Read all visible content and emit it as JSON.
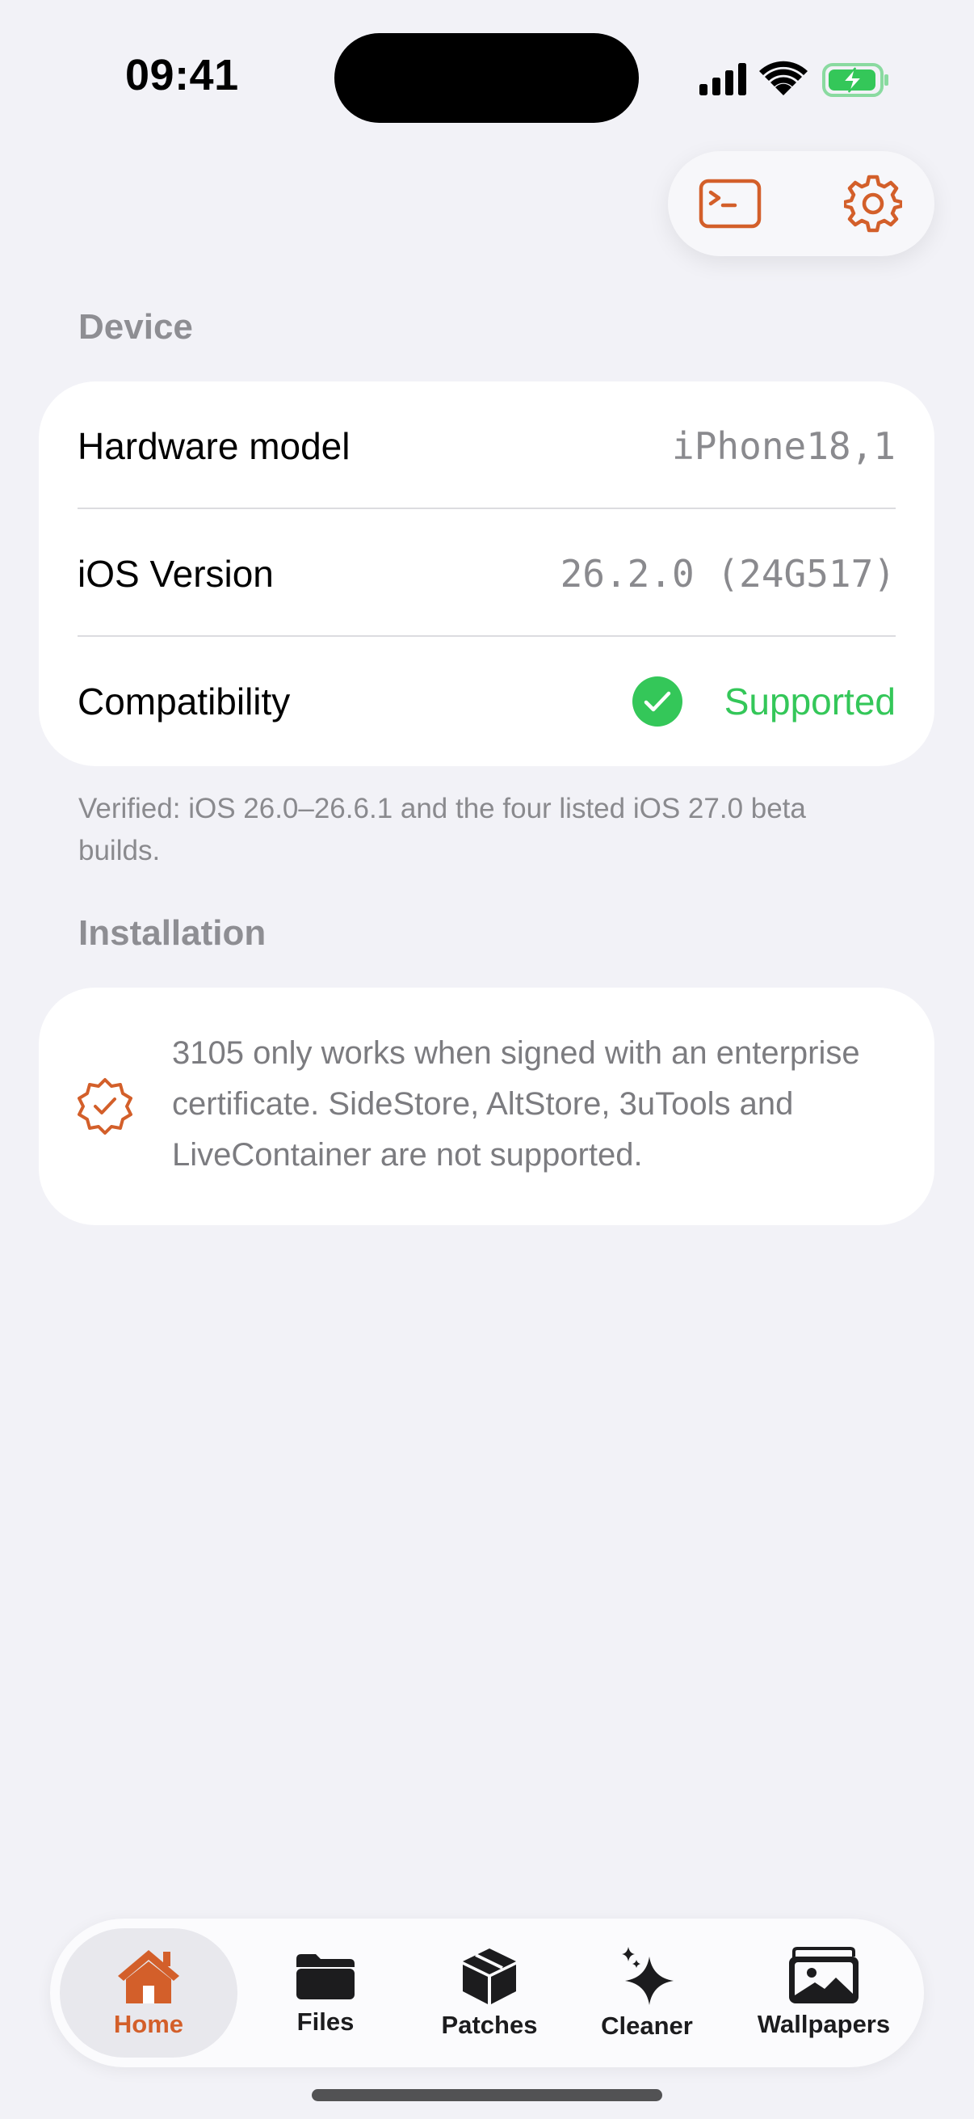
{
  "status_bar": {
    "time": "09:41"
  },
  "colors": {
    "accent": "#d35f2a",
    "success": "#34c759",
    "background": "#f2f2f7"
  },
  "toolbar": {
    "terminal_icon": "terminal-icon",
    "settings_icon": "gear-icon"
  },
  "device": {
    "header": "Device",
    "rows": [
      {
        "label": "Hardware model",
        "value": "iPhone18,1"
      },
      {
        "label": "iOS Version",
        "value": "26.2.0 (24G517)"
      },
      {
        "label": "Compatibility",
        "value": "Supported"
      }
    ],
    "footnote": "Verified: iOS 26.0–26.6.1 and the four listed iOS 27.0 beta builds."
  },
  "installation": {
    "header": "Installation",
    "icon": "checkmark-seal-icon",
    "text": "3105 only works when signed with an enterprise certificate. SideStore, AltStore, 3uTools and LiveContainer are not supported."
  },
  "tabs": [
    {
      "label": "Home",
      "icon": "house-icon",
      "active": true
    },
    {
      "label": "Files",
      "icon": "folder-icon",
      "active": false
    },
    {
      "label": "Patches",
      "icon": "cube-icon",
      "active": false
    },
    {
      "label": "Cleaner",
      "icon": "sparkles-icon",
      "active": false
    },
    {
      "label": "Wallpapers",
      "icon": "photos-icon",
      "active": false
    }
  ]
}
